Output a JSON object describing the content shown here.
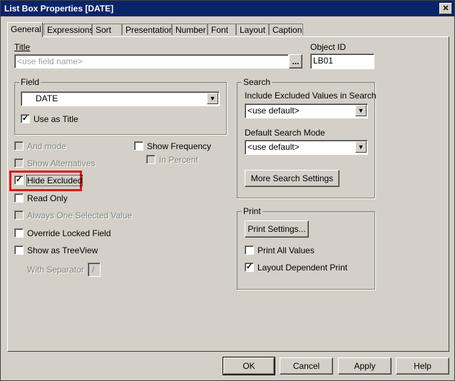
{
  "window": {
    "title": "List Box Properties [DATE]"
  },
  "tabs": [
    "General",
    "Expressions",
    "Sort",
    "Presentation",
    "Number",
    "Font",
    "Layout",
    "Caption"
  ],
  "title_field": {
    "label": "Title",
    "placeholder": "<use field name>",
    "browse": "..."
  },
  "object_id": {
    "label": "Object ID",
    "value": "LB01"
  },
  "field_group": {
    "label": "Field",
    "value": "DATE",
    "use_as_title": "Use as Title"
  },
  "options": {
    "and_mode": "And mode",
    "show_alternatives": "Show Alternatives",
    "hide_excluded": "Hide Excluded",
    "read_only": "Read Only",
    "always_one_selected": "Always One Selected Value",
    "override_locked": "Override Locked Field",
    "show_as_treeview": "Show as TreeView",
    "with_separator": "With Separator",
    "separator_value": "/",
    "show_frequency": "Show Frequency",
    "in_percent": "In Percent"
  },
  "search_group": {
    "label": "Search",
    "include_excluded_label": "Include Excluded Values in Search",
    "include_excluded_value": "<use default>",
    "default_mode_label": "Default Search Mode",
    "default_mode_value": "<use default>",
    "more_settings": "More Search Settings"
  },
  "print_group": {
    "label": "Print",
    "print_settings": "Print Settings...",
    "print_all_values": "Print All Values",
    "layout_dependent": "Layout Dependent Print"
  },
  "footer": {
    "ok": "OK",
    "cancel": "Cancel",
    "apply": "Apply",
    "help": "Help"
  },
  "colors": {
    "titlebar": "#0a246a",
    "face": "#d4d0c8",
    "highlight": "#e0141b"
  },
  "icons": {
    "close": "close-icon",
    "dropdown": "chevron-down-icon",
    "check": "check-icon"
  }
}
